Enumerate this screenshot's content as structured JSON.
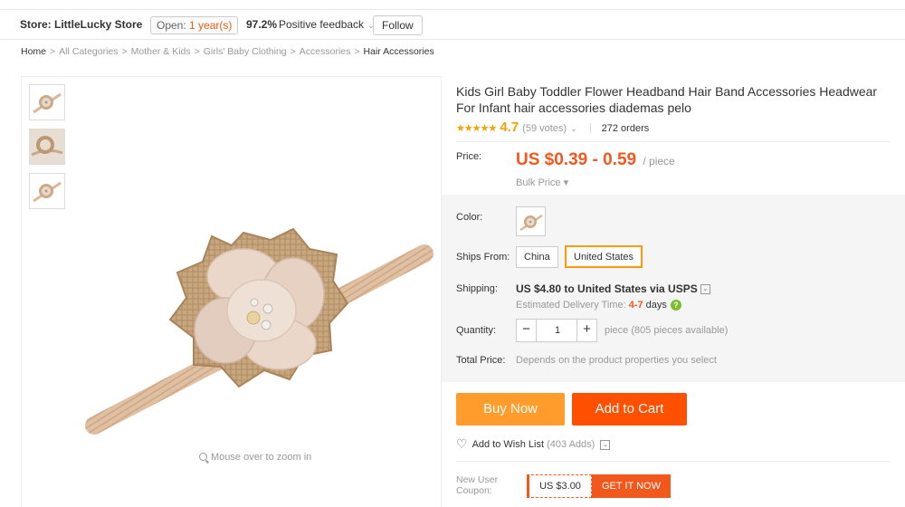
{
  "store": {
    "label": "Store:",
    "name": "LittleLucky Store",
    "open_prefix": "Open: ",
    "open_years": "1 year(s)",
    "feedback_pct": "97.2%",
    "feedback_label": "Positive feedback",
    "follow_label": "Follow"
  },
  "breadcrumb": [
    "Home",
    "All Categories",
    "Mother & Kids",
    "Girls' Baby Clothing",
    "Accessories",
    "Hair Accessories"
  ],
  "gallery": {
    "zoom_hint": "Mouse over to zoom in"
  },
  "product": {
    "title": "Kids Girl Baby Toddler Flower Headband Hair Band Accessories Headwear For Infant hair accessories diademas pelo",
    "rating": "4.7",
    "votes": "(59 votes)",
    "orders": "272 orders"
  },
  "price": {
    "label": "Price:",
    "value": "US $0.39 - 0.59",
    "unit": "/ piece",
    "bulk_label": "Bulk Price"
  },
  "options": {
    "color_label": "Color:",
    "ships_from_label": "Ships From:",
    "ships_from": [
      "China",
      "United States"
    ],
    "ships_from_selected": "United States",
    "shipping_label": "Shipping:",
    "shipping_value": "US $4.80 to United States via USPS",
    "delivery_prefix": "Estimated Delivery Time: ",
    "delivery_days": "4-7",
    "delivery_suffix": "days",
    "quantity_label": "Quantity:",
    "quantity_value": "1",
    "quantity_note": "piece (805 pieces available)",
    "total_label": "Total Price:",
    "total_note": "Depends on the product properties you select"
  },
  "actions": {
    "buy_now": "Buy Now",
    "add_to_cart": "Add to Cart",
    "wishlist": "Add to Wish List",
    "wishlist_count": "(403 Adds)"
  },
  "coupon": {
    "label_line1": "New User",
    "label_line2": "Coupon:",
    "value": "US $3.00",
    "cta": "GET IT NOW"
  },
  "colors": {
    "accent_orange": "#f2571c",
    "buy_now_bg": "#ff9c2b",
    "add_to_cart_bg": "#ff4f00",
    "star": "#f2a100",
    "selected_border": "#ff9903",
    "help_green": "#7bbd2a"
  }
}
